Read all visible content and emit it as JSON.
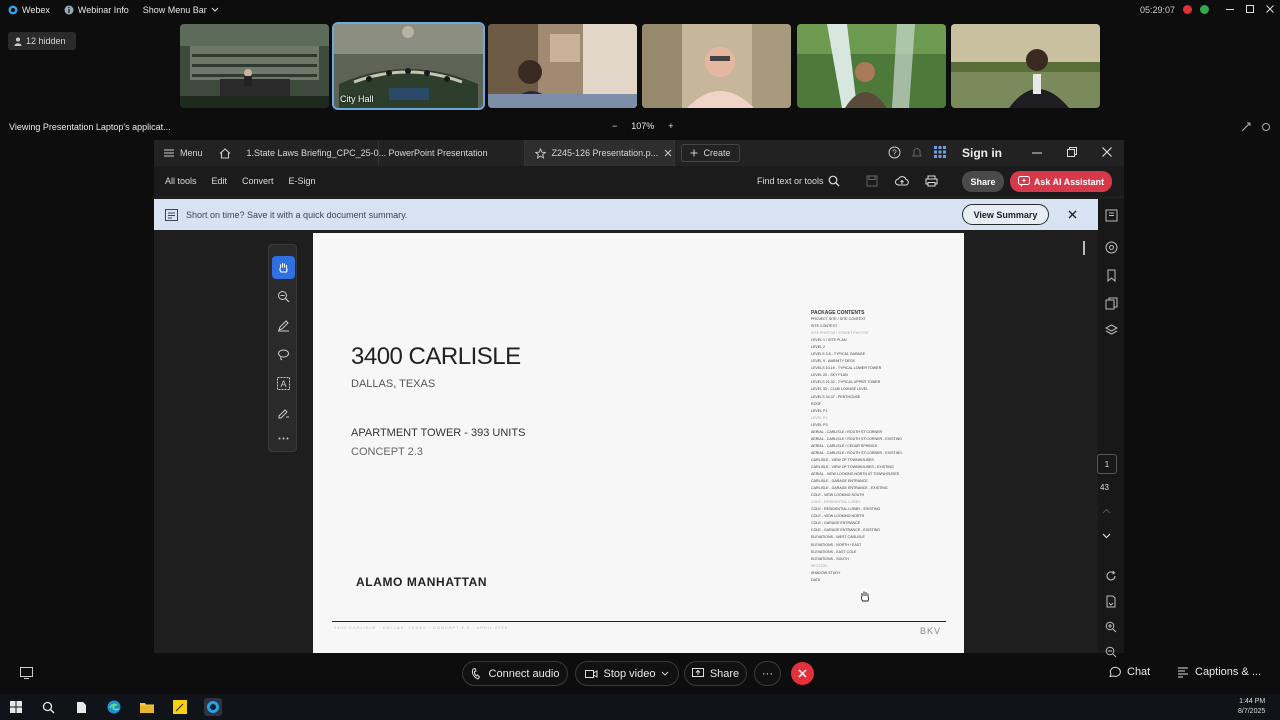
{
  "topbar": {
    "app": "Webex",
    "webinar_info": "Webinar Info",
    "show_menu": "Show Menu Bar",
    "timer": "05:29:07"
  },
  "participants": {
    "hidden_label": "12 hidden",
    "thumbs": [
      {
        "label": ""
      },
      {
        "label": "City Hall"
      },
      {
        "label": ""
      },
      {
        "label": ""
      },
      {
        "label": ""
      },
      {
        "label": ""
      }
    ]
  },
  "share": {
    "viewing": "Viewing Presentation Laptop's applicat...",
    "zoom": "107%",
    "zoom_out": "−",
    "zoom_in": "+"
  },
  "acrobat": {
    "tabs": [
      {
        "label": "Menu"
      },
      {
        "label": "1.State Laws Briefing_CPC_25-0..."
      },
      {
        "label": "PowerPoint Presentation"
      },
      {
        "label": "Z245-126 Presentation.p..."
      },
      {
        "label": "Create"
      }
    ],
    "sign_in": "Sign in",
    "toolbar": [
      "All tools",
      "Edit",
      "Convert",
      "E-Sign"
    ],
    "find": "Find text or tools",
    "share": "Share",
    "ai": "Ask AI Assistant",
    "notice": "Short on time? Save it with a quick document summary.",
    "view_summary": "View Summary",
    "page_current": "1",
    "page_total": "43"
  },
  "document": {
    "title": "3400 CARLISLE",
    "subtitle": "DALLAS, TEXAS",
    "type": "APARTMENT TOWER - 393 UNITS",
    "concept": "CONCEPT 2.3",
    "brand": "ALAMO MANHATTAN",
    "footer": "3400 CARLISLE  ·  DALLAS, TEXAS  ·  CONCEPT 2.3  ·  APRIL 2025",
    "mark": "BKV",
    "contents_title": "PACKAGE CONTENTS",
    "contents": [
      "PROJECT SITE / SITE CONTEXT",
      "SITE CONTEXT",
      "SITE PHOTOS / STREET PHOTOS",
      "LEVEL 1 / SITE PLAN",
      "LEVEL 2",
      "LEVELS 3-8 - TYPICAL GARAGE",
      "LEVEL 9 - AMENITY DECK",
      "LEVELS 10-19 - TYPICAL LOWER TOWER",
      "LEVEL 20 - SKY PLAN",
      "LEVELS 21-32 - TYPICAL UPPER TOWER",
      "LEVEL 33 - CLUB LOUNGE LEVEL",
      "LEVELS 34-37 - PENTHOUSE",
      "ROOF",
      "LEVEL P1",
      "LEVEL P2",
      "LEVEL P3",
      "AERIAL - CARLISLE / ROUTH ST CORNER",
      "AERIAL - CARLISLE / ROUTH ST CORNER - EXISTING",
      "AERIAL - CARLISLE / CEDAR SPRINGS",
      "AERIAL - CARLISLE / ROUTH ST CORNER - EXISTING",
      "CARLISLE - VIEW OF TOWNHOUSES",
      "CARLISLE - VIEW OF TOWNHOUSES - EXISTING",
      "AERIAL - VIEW LOOKING NORTH AT TOWNHOUSES",
      "CARLISLE - GARAGE ENTRANCE",
      "CARLISLE - GARAGE ENTRANCE - EXISTING",
      "COLE - VIEW LOOKING SOUTH",
      "COLE - RESIDENTIAL LOBBY",
      "COLE - RESIDENTIAL LOBBY - EXISTING",
      "COLE - VIEW LOOKING NORTH",
      "COLE - GARAGE ENTRANCE",
      "COLE - GARAGE ENTRANCE - EXISTING",
      "ELEVATIONS - WEST CARLISLE",
      "ELEVATIONS - NORTH / EAST",
      "ELEVATIONS - EAST COLE",
      "ELEVATIONS - SOUTH",
      "SECTION",
      "SHADOW STUDY",
      "DATA"
    ]
  },
  "controls": {
    "connect_audio": "Connect audio",
    "stop_video": "Stop video",
    "share": "Share",
    "more": "···",
    "chat": "Chat",
    "captions": "Captions & ..."
  },
  "taskbar": {
    "time": "1:44 PM",
    "date": "8/7/2025"
  },
  "colors": {
    "accent_ai": "#d63a4a",
    "end_call": "#e2313b",
    "selected_tool": "#2f6fe0"
  }
}
